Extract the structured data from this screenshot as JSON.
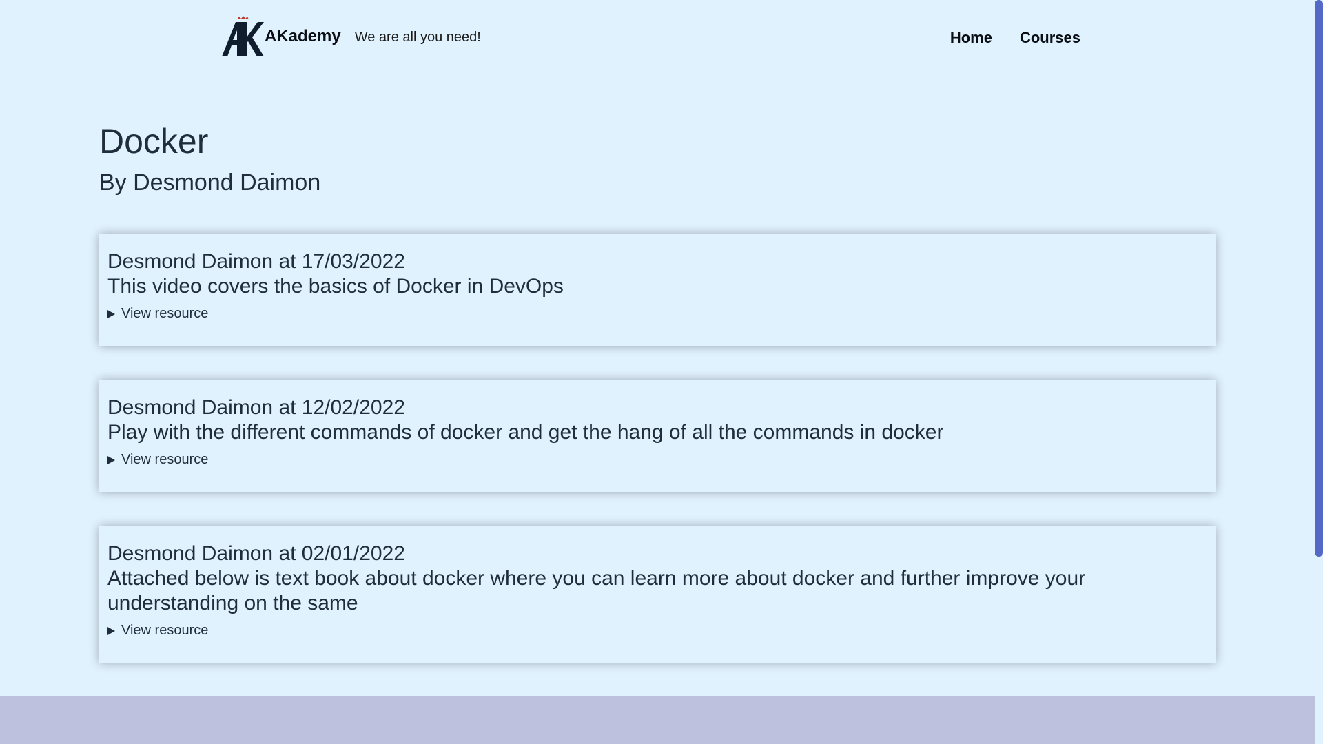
{
  "header": {
    "brand_name": "AKademy",
    "tagline": "We are all you need!",
    "logo_icon": "akademy-logo-icon",
    "nav": [
      {
        "label": "Home"
      },
      {
        "label": "Courses"
      }
    ]
  },
  "course": {
    "title": "Docker",
    "author": "By Desmond Daimon"
  },
  "resources": [
    {
      "meta": "Desmond Daimon at 17/03/2022",
      "description": "This video covers the basics of Docker in DevOps",
      "toggle_label": "View resource"
    },
    {
      "meta": "Desmond Daimon at 12/02/2022",
      "description": "Play with the different commands of docker and get the hang of all the commands in docker",
      "toggle_label": "View resource"
    },
    {
      "meta": "Desmond Daimon at 02/01/2022",
      "description": "Attached below is text book about docker where you can learn more about docker and further improve your understanding on the same",
      "toggle_label": "View resource"
    }
  ],
  "colors": {
    "background": "#e0f2fe",
    "footer": "#bec1dd",
    "scrollbar_thumb": "#5468c8",
    "text": "#1f2d3d"
  }
}
